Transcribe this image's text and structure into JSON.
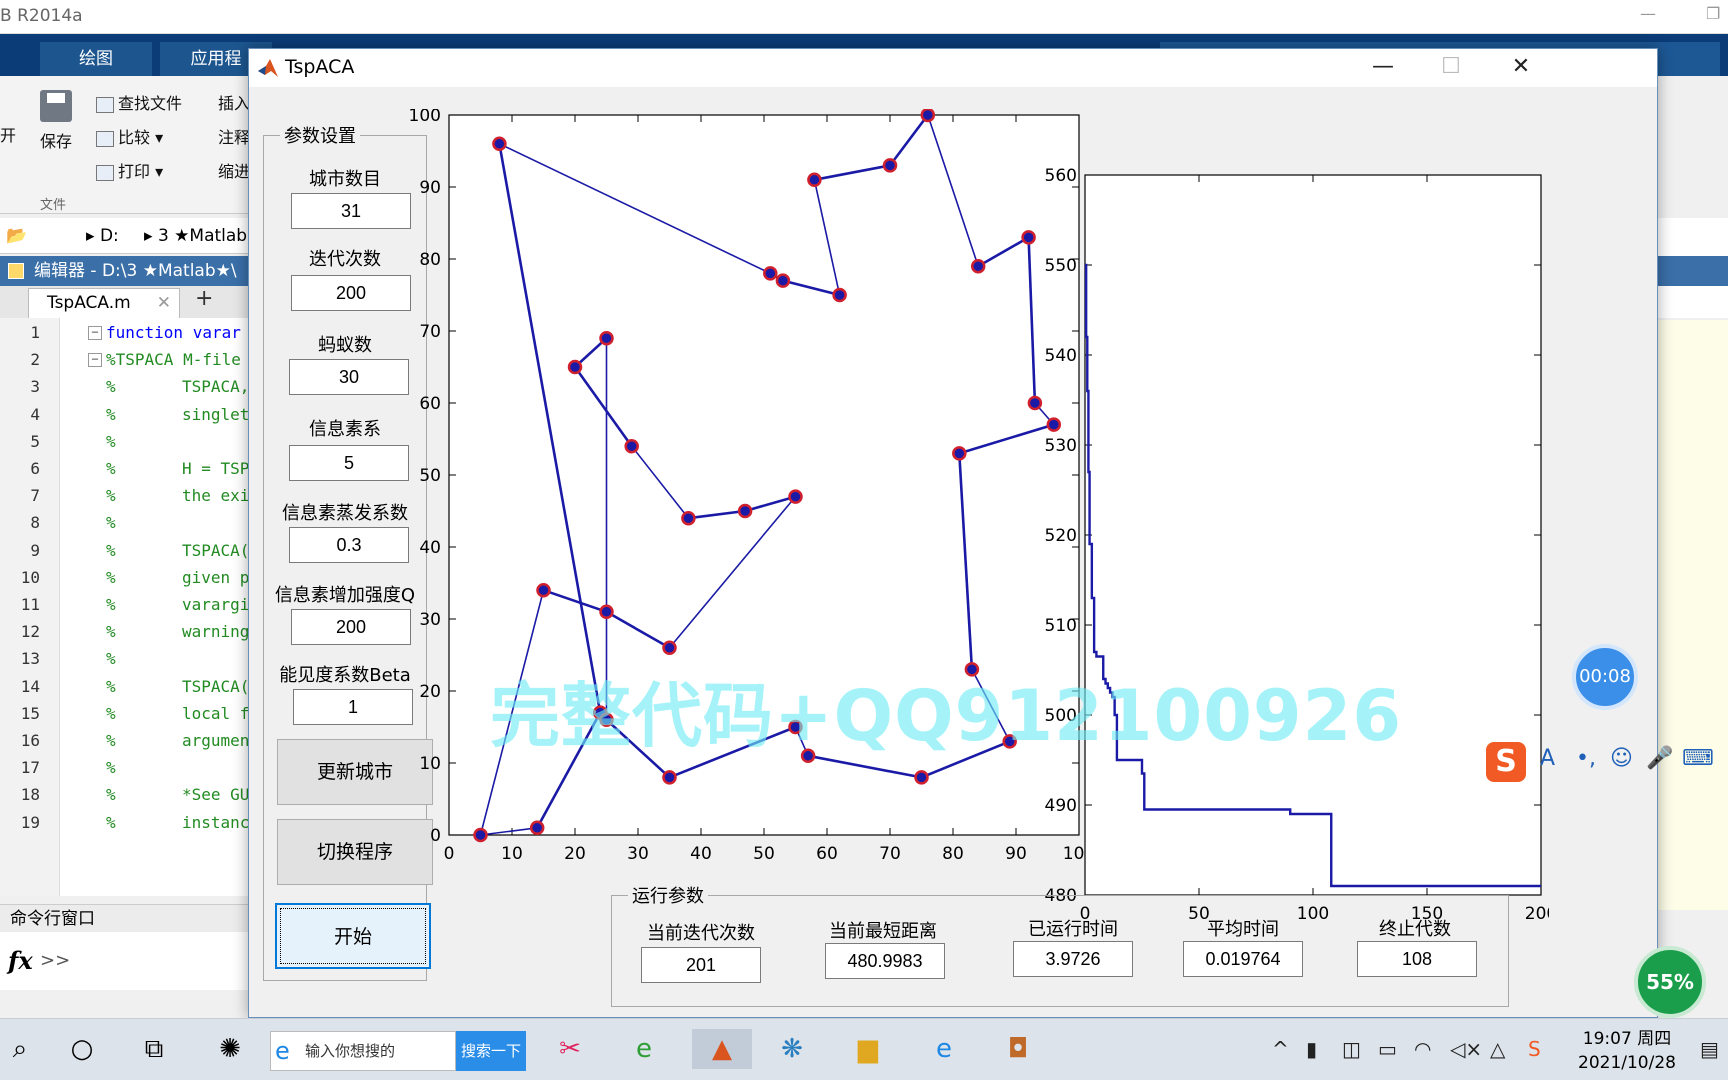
{
  "matlab": {
    "title": "B R2014a",
    "ribbon_tabs": [
      "绘图",
      "应用程"
    ],
    "ribbon": {
      "open": "开",
      "save": "保存",
      "find_files": "查找文件",
      "compare": "比较",
      "print": "打印",
      "insert": "插入",
      "comment": "注释",
      "indent": "缩进",
      "section": "文件"
    },
    "path": {
      "drive": "D:",
      "folder": "3 ★Matlab"
    },
    "editor_title": "编辑器 - D:\\3 ★Matlab★\\",
    "editor_tab": "TspACA.m",
    "code_lines": [
      {
        "n": "1",
        "kind": "kw",
        "text": "function varar"
      },
      {
        "n": "2",
        "kind": "cm",
        "text": "%TSPACA M-file"
      },
      {
        "n": "3",
        "kind": "pc",
        "text": "TSPACA,"
      },
      {
        "n": "4",
        "kind": "pc",
        "text": "singlet"
      },
      {
        "n": "5",
        "kind": "pc",
        "text": ""
      },
      {
        "n": "6",
        "kind": "pc",
        "text": "H = TSP"
      },
      {
        "n": "7",
        "kind": "pc",
        "text": "the exi"
      },
      {
        "n": "8",
        "kind": "pc",
        "text": ""
      },
      {
        "n": "9",
        "kind": "pc",
        "text": "TSPACA("
      },
      {
        "n": "10",
        "kind": "pc",
        "text": "given p"
      },
      {
        "n": "11",
        "kind": "pc",
        "text": "varargi"
      },
      {
        "n": "12",
        "kind": "pc",
        "text": "warning"
      },
      {
        "n": "13",
        "kind": "pc",
        "text": ""
      },
      {
        "n": "14",
        "kind": "pc",
        "text": "TSPACA("
      },
      {
        "n": "15",
        "kind": "pc",
        "text": "local f"
      },
      {
        "n": "16",
        "kind": "pc",
        "text": "argumen"
      },
      {
        "n": "17",
        "kind": "pc",
        "text": ""
      },
      {
        "n": "18",
        "kind": "pc",
        "text": "*See GU"
      },
      {
        "n": "19",
        "kind": "pc",
        "text": "instanc"
      }
    ],
    "cmd_title": "命令行窗口",
    "cmd_fx": "fx",
    "cmd_prompt": ">>"
  },
  "window": {
    "title": "TspACA",
    "minimize": "—",
    "maximize": "☐",
    "close": "✕"
  },
  "params": {
    "group_title": "参数设置",
    "city_count": {
      "label": "城市数目",
      "value": "31"
    },
    "iterations": {
      "label": "迭代次数",
      "value": "200"
    },
    "ants": {
      "label": "蚂蚁数",
      "value": "30"
    },
    "pheromone_coef": {
      "label": "信息素系",
      "value": "5"
    },
    "evaporation": {
      "label": "信息素蒸发系数",
      "value": "0.3"
    },
    "pheromone_q": {
      "label": "信息素增加强度Q",
      "value": "200"
    },
    "visibility_beta": {
      "label": "能见度系数Beta",
      "value": "1"
    },
    "btn_update_cities": "更新城市",
    "btn_switch_program": "切换程序",
    "btn_start": "开始"
  },
  "run": {
    "group_title": "运行参数",
    "current_iter": {
      "label": "当前迭代次数",
      "value": "201"
    },
    "best_distance": {
      "label": "当前最短距离",
      "value": "480.9983"
    },
    "elapsed": {
      "label": "已运行时间",
      "value": "3.9726"
    },
    "avg_time": {
      "label": "平均时间",
      "value": "0.019764"
    },
    "stop_gen": {
      "label": "终止代数",
      "value": "108"
    }
  },
  "overlay": {
    "watermark": "完整代码+QQ912100926",
    "timer": "00:08",
    "badge": "55%"
  },
  "taskbar": {
    "search_placeholder": "输入你想搜的",
    "search_button": "搜索一下",
    "time": "19:07 周四",
    "date": "2021/10/28"
  },
  "chart_data": [
    {
      "type": "line",
      "xlim": [
        0,
        100
      ],
      "ylim": [
        0,
        100
      ],
      "xticks": [
        0,
        10,
        20,
        30,
        40,
        50,
        60,
        70,
        80,
        90,
        100
      ],
      "yticks": [
        0,
        10,
        20,
        30,
        40,
        50,
        60,
        70,
        80,
        90,
        100
      ],
      "line_color": "#1a1aa6",
      "marker_color": "#d0202e",
      "tour": [
        [
          5,
          0
        ],
        [
          14,
          1
        ],
        [
          24,
          17
        ],
        [
          8,
          96
        ],
        [
          51,
          78
        ],
        [
          53,
          77
        ],
        [
          62,
          75
        ],
        [
          58,
          91
        ],
        [
          70,
          93
        ],
        [
          76,
          100
        ],
        [
          84,
          79
        ],
        [
          92,
          83
        ],
        [
          93,
          60
        ],
        [
          96,
          57
        ],
        [
          81,
          53
        ],
        [
          83,
          23
        ],
        [
          89,
          13
        ],
        [
          75,
          8
        ],
        [
          57,
          11
        ],
        [
          55,
          15
        ],
        [
          35,
          8
        ],
        [
          25,
          16
        ],
        [
          25,
          69
        ],
        [
          20,
          65
        ],
        [
          29,
          54
        ],
        [
          38,
          44
        ],
        [
          47,
          45
        ],
        [
          55,
          47
        ],
        [
          35,
          26
        ],
        [
          25,
          31
        ],
        [
          15,
          34
        ],
        [
          5,
          0
        ]
      ]
    },
    {
      "type": "line",
      "xlim": [
        0,
        200
      ],
      "ylim": [
        480,
        560
      ],
      "xticks": [
        0,
        50,
        100,
        150,
        200
      ],
      "yticks": [
        480,
        490,
        500,
        510,
        520,
        530,
        540,
        550,
        560
      ],
      "line_color": "#1a1aa6",
      "x": [
        0,
        0.5,
        1,
        1.5,
        2,
        3,
        4,
        5,
        6,
        7,
        8,
        9,
        10,
        11,
        12,
        13,
        14,
        15,
        16,
        17,
        18,
        20,
        22,
        24,
        25,
        26,
        27,
        28,
        30,
        40,
        60,
        80,
        90,
        100,
        108,
        108,
        150,
        200
      ],
      "y": [
        550,
        542,
        536,
        527,
        519,
        513,
        507,
        506.5,
        506.5,
        506.5,
        504,
        503.5,
        503,
        502.5,
        502,
        500,
        495,
        495,
        495,
        495,
        495,
        495,
        495,
        495,
        493.5,
        489.5,
        489.5,
        489.5,
        489.5,
        489.5,
        489.5,
        489.5,
        489,
        489,
        489,
        481,
        481,
        481
      ]
    }
  ]
}
